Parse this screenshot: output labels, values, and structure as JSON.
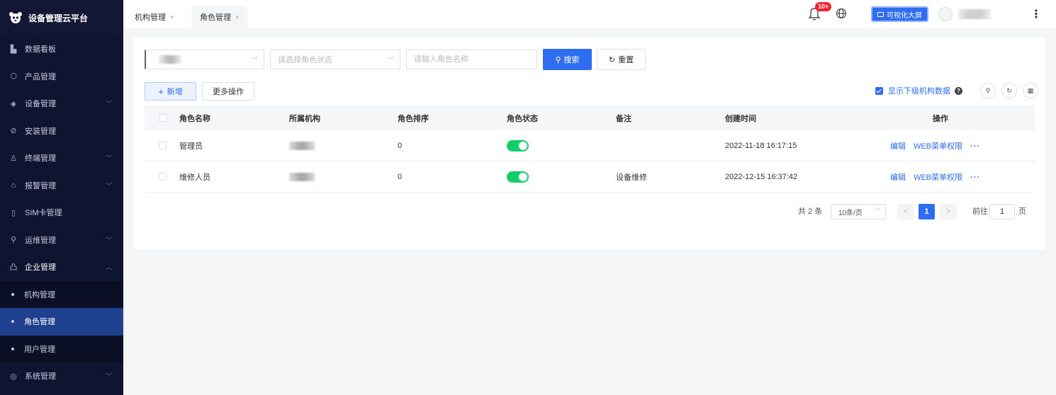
{
  "app": {
    "title": "设备管理云平台"
  },
  "sidebar": {
    "items": [
      {
        "label": "数据看板",
        "icon": "bar-chart-icon",
        "chevron": false
      },
      {
        "label": "产品管理",
        "icon": "cube-icon",
        "chevron": false
      },
      {
        "label": "设备管理",
        "icon": "layers-icon",
        "chevron": true
      },
      {
        "label": "安装管理",
        "icon": "compass-icon",
        "chevron": false
      },
      {
        "label": "终端管理",
        "icon": "user-icon",
        "chevron": true
      },
      {
        "label": "报警管理",
        "icon": "alarm-icon",
        "chevron": true
      },
      {
        "label": "SIM卡管理",
        "icon": "sim-card-icon",
        "chevron": false
      },
      {
        "label": "运维管理",
        "icon": "wrench-icon",
        "chevron": true
      },
      {
        "label": "企业管理",
        "icon": "building-icon",
        "chevron": true,
        "open": true
      },
      {
        "label": "机构管理",
        "sub": true
      },
      {
        "label": "角色管理",
        "sub": true,
        "active": true
      },
      {
        "label": "用户管理",
        "sub": true
      },
      {
        "label": "系统管理",
        "icon": "settings-icon",
        "chevron": true
      }
    ]
  },
  "tabs": [
    {
      "label": "机构管理",
      "close": "×"
    },
    {
      "label": "角色管理",
      "close": "×",
      "active": true
    }
  ],
  "header": {
    "notification_count": "10+",
    "bigscreen_label": "可视化大屏"
  },
  "filters": {
    "status_placeholder": "请选择角色状态",
    "name_placeholder": "请输入角色名称",
    "search_label": "搜索",
    "reset_label": "重置"
  },
  "toolbar": {
    "add_label": "新增",
    "more_label": "更多操作",
    "show_sub_label": "显示下级机构数据"
  },
  "table": {
    "columns": [
      "角色名称",
      "所属机构",
      "角色排序",
      "角色状态",
      "备注",
      "创建时间",
      "操作"
    ],
    "rows": [
      {
        "name": "管理员",
        "sort": "0",
        "status_on": true,
        "remark": "",
        "created": "2022-11-18 16:17:15"
      },
      {
        "name": "维修人员",
        "sort": "0",
        "status_on": true,
        "remark": "设备维修",
        "created": "2022-12-15 16:37:42"
      }
    ],
    "ops": {
      "edit": "编辑",
      "web_menu": "WEB菜单权限",
      "more": "···"
    }
  },
  "pagination": {
    "total_text": "共 2 条",
    "page_size": "10条/页",
    "prev": "<",
    "next": ">",
    "current_page": "1",
    "goto_prefix": "前往",
    "goto_value": "1",
    "goto_suffix": "页"
  },
  "colors": {
    "sidebar_bg": "#0f1430",
    "primary": "#2e6df0",
    "active_nav": "#1f3f8f",
    "switch_on": "#13ce66",
    "badge": "#f5222d"
  }
}
